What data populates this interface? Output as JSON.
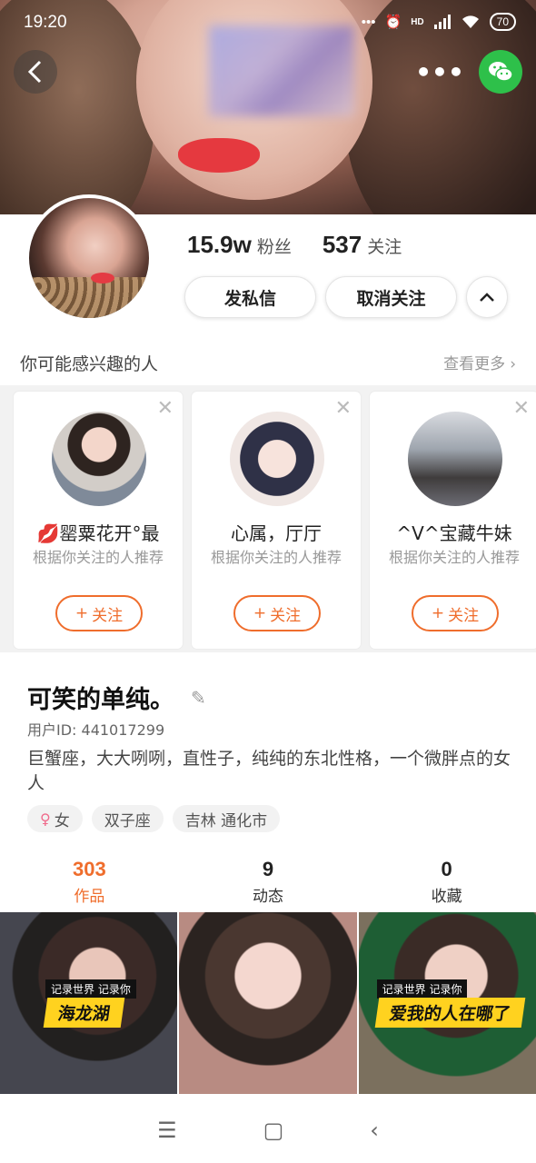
{
  "status": {
    "time": "19:20",
    "signal": "•••",
    "alarm": "⏰",
    "network": "HD",
    "battery": "70"
  },
  "header": {
    "more": "•••"
  },
  "stats": {
    "fans_value": "15.9w",
    "fans_label": "粉丝",
    "following_value": "537",
    "following_label": "关注"
  },
  "actions": {
    "message": "发私信",
    "unfollow": "取消关注"
  },
  "recommend": {
    "title": "你可能感兴趣的人",
    "more": "查看更多",
    "follow_plus": "+",
    "follow_label": "关注",
    "items": [
      {
        "name": "💋罂粟花开°最",
        "reason": "根据你关注的人推荐"
      },
      {
        "name": "心属，厅厅",
        "reason": "根据你关注的人推荐"
      },
      {
        "name": "^V^宝藏牛妹",
        "reason": "根据你关注的人推荐"
      }
    ]
  },
  "profile": {
    "nickname": "可笑的单纯。",
    "user_id": "用户ID: 441017299",
    "bio": "巨蟹座，大大咧咧，直性子，纯纯的东北性格，一个微胖点的女人",
    "tags": {
      "gender": "女",
      "zodiac": "双子座",
      "location": "吉林 通化市"
    }
  },
  "tabs": [
    {
      "count": "303",
      "label": "作品"
    },
    {
      "count": "9",
      "label": "动态"
    },
    {
      "count": "0",
      "label": "收藏"
    }
  ],
  "works": [
    {
      "small": "记录世界 记录你",
      "big": "海龙湖"
    },
    {
      "small": "",
      "big": ""
    },
    {
      "small": "记录世界 记录你",
      "big": "爱我的人在哪了"
    }
  ],
  "colors": {
    "accent": "#ef6d2c",
    "wechat": "#2ec04a",
    "caption_bg": "#ffd21f"
  }
}
